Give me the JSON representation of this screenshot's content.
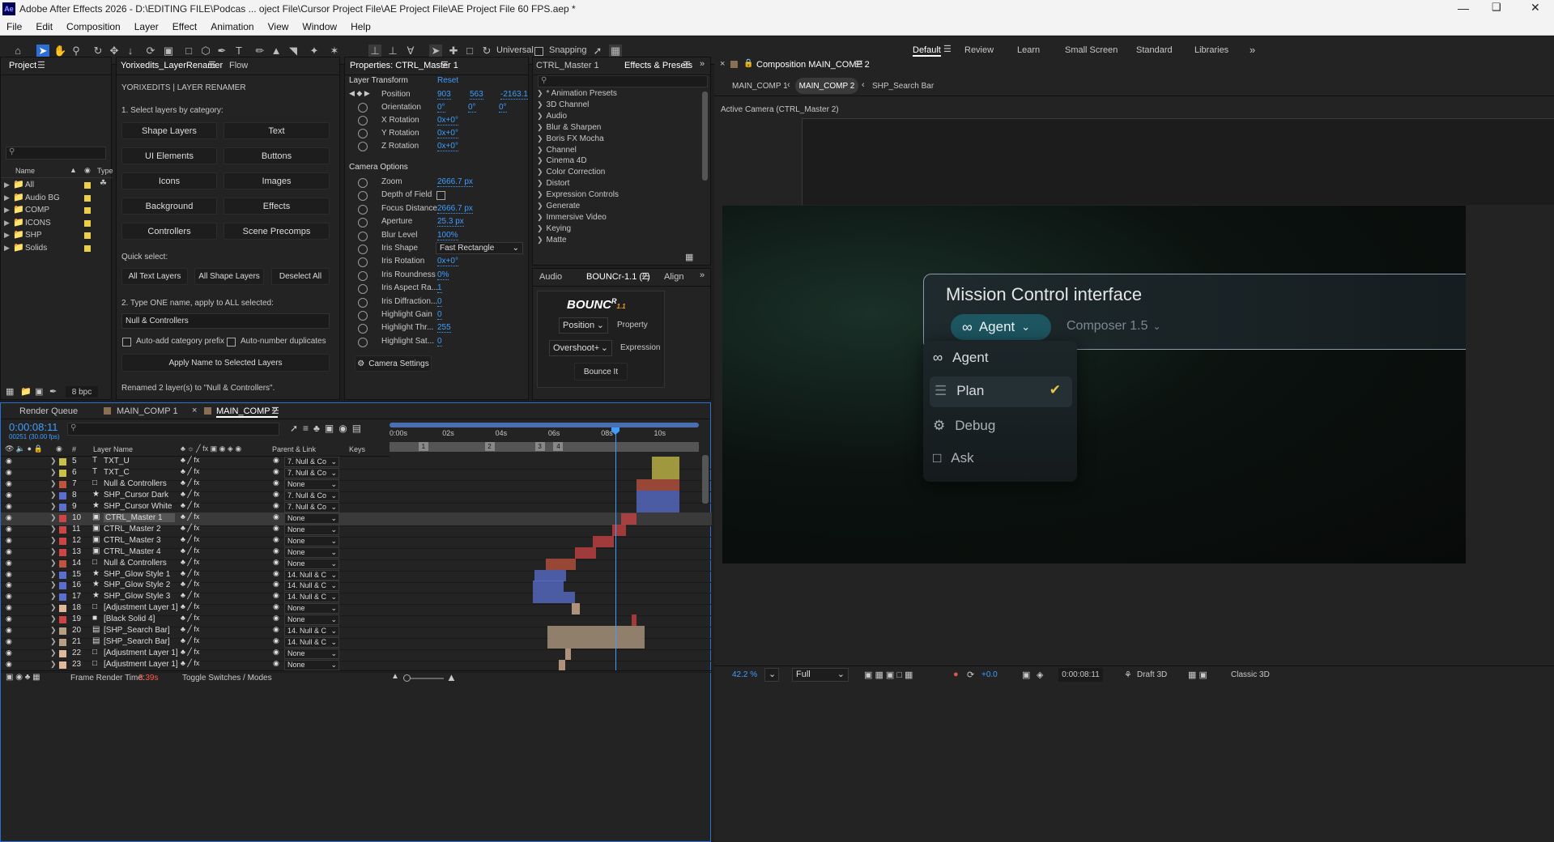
{
  "app": {
    "title": "Adobe After Effects 2026 - D:\\EDITING FILE\\Podcas ... oject File\\Cursor Project File\\AE Project File\\AE Project File 60 FPS.aep *",
    "logo": "Ae"
  },
  "menu": [
    "File",
    "Edit",
    "Composition",
    "Layer",
    "Effect",
    "Animation",
    "View",
    "Window",
    "Help"
  ],
  "toolbar": {
    "universal": "Universal",
    "snapping": "Snapping",
    "workspaces": [
      "Default",
      "Review",
      "Learn",
      "Small Screen",
      "Standard",
      "Libraries"
    ]
  },
  "project": {
    "tab": "Project",
    "search_placeholder": "",
    "col_name": "Name",
    "col_type": "Type",
    "folders": [
      "All",
      "Audio BG",
      "COMP",
      "ICONS",
      "SHP",
      "Solids"
    ],
    "bpc": "8 bpc"
  },
  "renamer": {
    "tab": "Yorixedits_LayerRenamer",
    "tab2": "Flow",
    "heading": "YORIXEDITS | LAYER RENAMER",
    "step1": "1. Select layers by category:",
    "categories": [
      "Shape Layers",
      "Text",
      "UI Elements",
      "Buttons",
      "Icons",
      "Images",
      "Background",
      "Effects",
      "Controllers",
      "Scene Precomps"
    ],
    "quick_select": "Quick select:",
    "quick": [
      "All Text Layers",
      "All Shape Layers",
      "Deselect All"
    ],
    "step2": "2. Type ONE name, apply to ALL selected:",
    "name_value": "Null & Controllers",
    "opt1": "Auto-add category prefix",
    "opt2": "Auto-number duplicates",
    "apply": "Apply Name to Selected Layers",
    "status": "Renamed 2 layer(s) to \"Null & Controllers\"."
  },
  "properties": {
    "tab": "Properties: CTRL_Master 1",
    "layer_transform": "Layer Transform",
    "reset": "Reset",
    "position": {
      "label": "Position",
      "x": "903",
      "y": "563",
      "z": "-2163.1"
    },
    "orientation": {
      "label": "Orientation",
      "x": "0°",
      "y": "0°",
      "z": "0°"
    },
    "rotations": [
      {
        "label": "X Rotation",
        "value": "0x+0°"
      },
      {
        "label": "Y Rotation",
        "value": "0x+0°"
      },
      {
        "label": "Z Rotation",
        "value": "0x+0°"
      }
    ],
    "camera_options": "Camera Options",
    "camera": [
      {
        "label": "Zoom",
        "value": "2666.7 px"
      },
      {
        "label": "Depth of Field",
        "value": ""
      },
      {
        "label": "Focus Distance",
        "value": "2666.7 px"
      },
      {
        "label": "Aperture",
        "value": "25.3 px"
      },
      {
        "label": "Blur Level",
        "value": "100%"
      },
      {
        "label": "Iris Shape",
        "value": "Fast Rectangle"
      },
      {
        "label": "Iris Rotation",
        "value": "0x+0°"
      },
      {
        "label": "Iris Roundness",
        "value": "0%"
      },
      {
        "label": "Iris Aspect Ra...",
        "value": "1"
      },
      {
        "label": "Iris Diffraction...",
        "value": "0"
      },
      {
        "label": "Highlight Gain",
        "value": "0"
      },
      {
        "label": "Highlight Thr...",
        "value": "255"
      },
      {
        "label": "Highlight Sat...",
        "value": "0"
      }
    ],
    "camera_settings": "Camera Settings"
  },
  "effects": {
    "tab1": "CTRL_Master 1",
    "tab2": "Effects & Presets",
    "items": [
      "* Animation Presets",
      "3D Channel",
      "Audio",
      "Blur & Sharpen",
      "Boris FX Mocha",
      "Channel",
      "Cinema 4D",
      "Color Correction",
      "Distort",
      "Expression Controls",
      "Generate",
      "Immersive Video",
      "Keying",
      "Matte"
    ]
  },
  "bounce": {
    "tab_audio": "Audio",
    "tab": "BOUNCr-1.1 (2)",
    "tab_align": "Align",
    "logo": "BOUNC",
    "logo_sup": "R",
    "logo_ver": "1.1",
    "property_value": "Position",
    "property_label": "Property",
    "expression_value": "Overshoot+",
    "expression_label": "Expression",
    "button": "Bounce It"
  },
  "composition": {
    "tab": "Composition MAIN_COMP 2",
    "crumbs": [
      "MAIN_COMP 1",
      "MAIN_COMP 2",
      "SHP_Search Bar"
    ],
    "camera": "Active Camera (CTRL_Master 2)",
    "mc_title": "Mission Control interface",
    "agent_pill": "Agent",
    "composer": "Composer 1.5",
    "menu": [
      "Agent",
      "Plan",
      "Debug",
      "Ask"
    ],
    "zoom": "42.2 %",
    "resolution": "Full",
    "exposure": "+0.0",
    "timecode": "0:00:08:11",
    "renderer": "Draft 3D",
    "mode": "Classic 3D"
  },
  "timeline": {
    "tabs": [
      "Render Queue",
      "MAIN_COMP 1",
      "MAIN_COMP 2"
    ],
    "timecode": "0:00:08:11",
    "frames": "00251 (30.00 fps)",
    "col_name": "Layer Name",
    "col_parent": "Parent & Link",
    "col_keys": "Keys",
    "ruler": [
      "0:00s",
      "02s",
      "04s",
      "06s",
      "08s",
      "10s"
    ],
    "markers": [
      "1",
      "2",
      "3",
      "4"
    ],
    "layers": [
      {
        "n": "5",
        "name": "TXT_U",
        "icon": "T",
        "parent": "7. Null & Co",
        "color": "#c9c04a"
      },
      {
        "n": "6",
        "name": "TXT_C",
        "icon": "T",
        "parent": "7. Null & Co",
        "color": "#c9c04a"
      },
      {
        "n": "7",
        "name": "Null & Controllers",
        "icon": "□",
        "parent": "None",
        "color": "#c0533c"
      },
      {
        "n": "8",
        "name": "SHP_Cursor Dark",
        "icon": "★",
        "parent": "7. Null & Co",
        "color": "#5a6fd0"
      },
      {
        "n": "9",
        "name": "SHP_Cursor White",
        "icon": "★",
        "parent": "7. Null & Co",
        "color": "#5a6fd0"
      },
      {
        "n": "10",
        "name": "CTRL_Master 1",
        "icon": "▣",
        "parent": "None",
        "color": "#c44"
      },
      {
        "n": "11",
        "name": "CTRL_Master 2",
        "icon": "▣",
        "parent": "None",
        "color": "#c44"
      },
      {
        "n": "12",
        "name": "CTRL_Master 3",
        "icon": "▣",
        "parent": "None",
        "color": "#c44"
      },
      {
        "n": "13",
        "name": "CTRL_Master 4",
        "icon": "▣",
        "parent": "None",
        "color": "#c44"
      },
      {
        "n": "14",
        "name": "Null & Controllers",
        "icon": "□",
        "parent": "None",
        "color": "#c0533c"
      },
      {
        "n": "15",
        "name": "SHP_Glow Style 1",
        "icon": "★",
        "parent": "14. Null & C",
        "color": "#5a6fd0"
      },
      {
        "n": "16",
        "name": "SHP_Glow Style 2",
        "icon": "★",
        "parent": "14. Null & C",
        "color": "#5a6fd0"
      },
      {
        "n": "17",
        "name": "SHP_Glow Style 3",
        "icon": "★",
        "parent": "14. Null & C",
        "color": "#5a6fd0"
      },
      {
        "n": "18",
        "name": "[Adjustment Layer 1]",
        "icon": "□",
        "parent": "None",
        "color": "#e0b89a"
      },
      {
        "n": "19",
        "name": "[Black Solid 4]",
        "icon": "■",
        "parent": "None",
        "color": "#c44"
      },
      {
        "n": "20",
        "name": "[SHP_Search Bar]",
        "icon": "▤",
        "parent": "14. Null & C",
        "color": "#b5a084"
      },
      {
        "n": "21",
        "name": "[SHP_Search Bar]",
        "icon": "▤",
        "parent": "14. Null & C",
        "color": "#b5a084"
      },
      {
        "n": "22",
        "name": "[Adjustment Layer 1]",
        "icon": "□",
        "parent": "None",
        "color": "#e0b89a"
      },
      {
        "n": "23",
        "name": "[Adjustment Layer 1]",
        "icon": "□",
        "parent": "None",
        "color": "#e0b89a"
      }
    ],
    "footer_label": "Frame Render Time:",
    "render_time": "3.39s",
    "toggle": "Toggle Switches / Modes"
  }
}
